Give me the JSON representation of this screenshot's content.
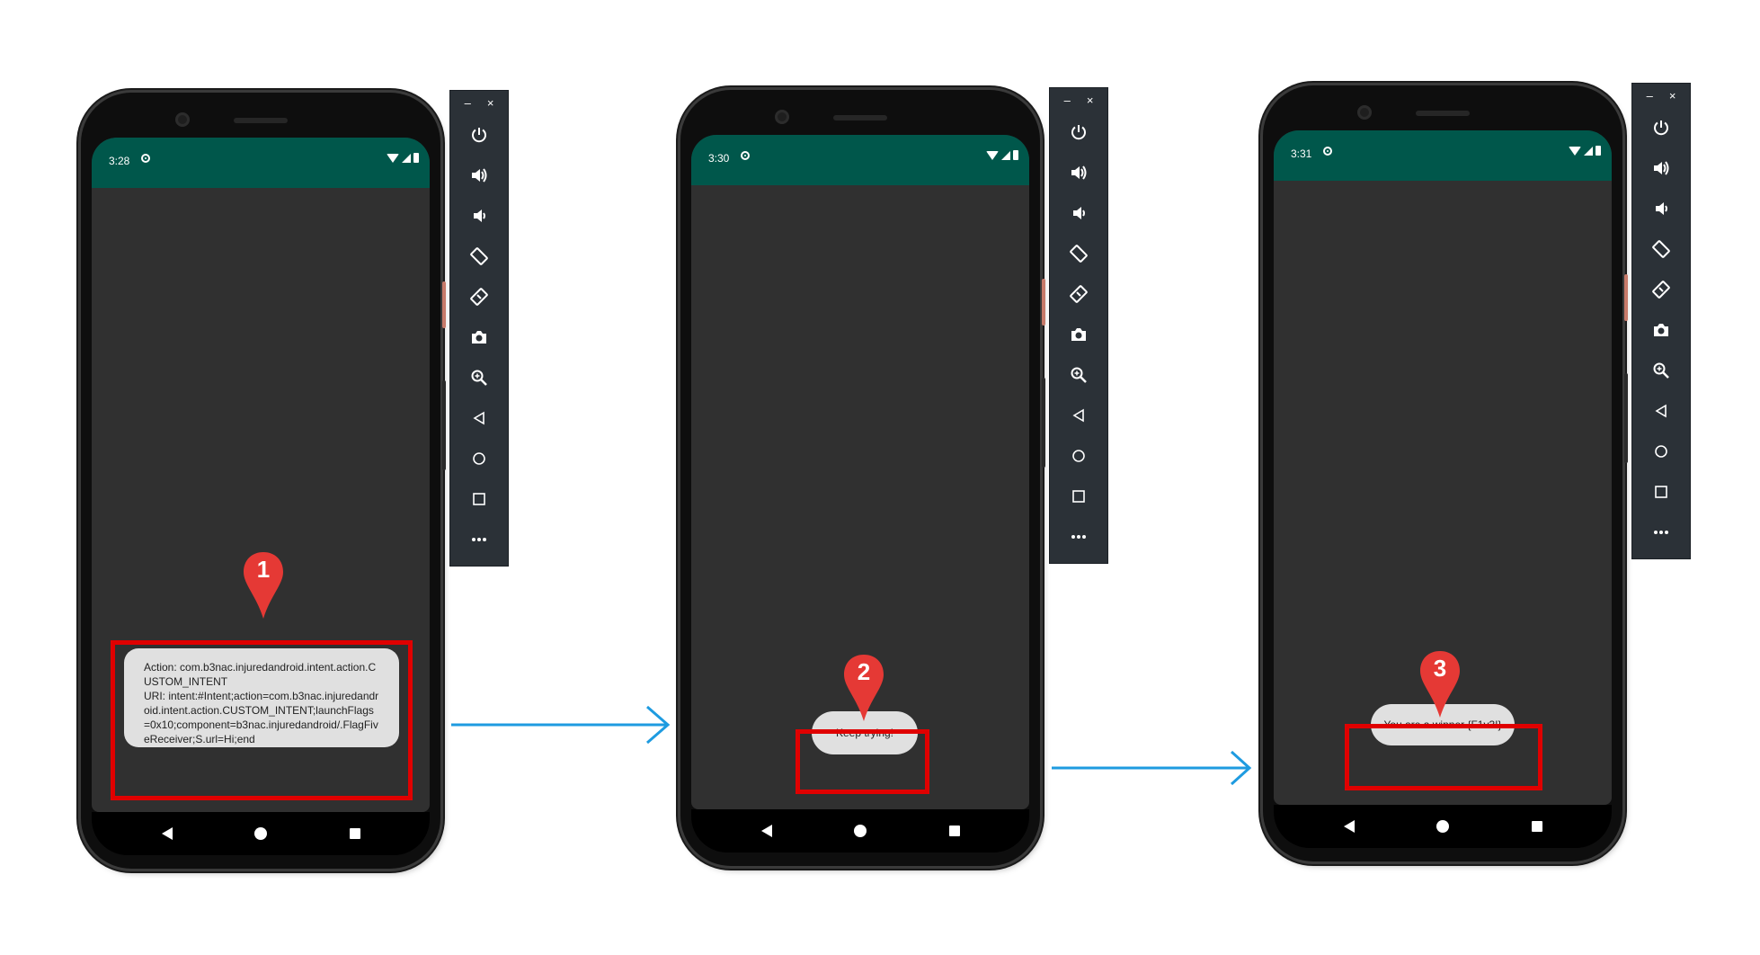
{
  "screens": [
    {
      "time": "3:28",
      "toast_text": "Action: com.b3nac.injuredandroid.intent.action.CUSTOM_INTENT\nURI: intent:#Intent;action=com.b3nac.injuredandroid.intent.action.CUSTOM_INTENT;launchFlags=0x10;component=b3nac.injuredandroid/.FlagFiveReceiver;S.url=Hi;end",
      "marker": "1"
    },
    {
      "time": "3:30",
      "toast_text": "Keep trying!",
      "marker": "2"
    },
    {
      "time": "3:31",
      "toast_text": "You are a winner {F1v3!}",
      "marker": "3"
    }
  ],
  "emulator_toolbar": {
    "window_controls": [
      "–",
      "×"
    ],
    "tools": [
      "power-icon",
      "volume-up-icon",
      "volume-down-icon",
      "rotate-left-icon",
      "rotate-right-icon",
      "camera-icon",
      "zoom-icon",
      "back-icon",
      "home-icon",
      "overview-icon",
      "more-icon"
    ]
  },
  "colors": {
    "status_bar": "#00574b",
    "screen_background": "#303030",
    "toast_background": "#e0e0e0",
    "highlight": "#e00000",
    "marker": "#e53935",
    "flow_arrow": "#1e9be0",
    "toolbar": "#2b3137"
  }
}
